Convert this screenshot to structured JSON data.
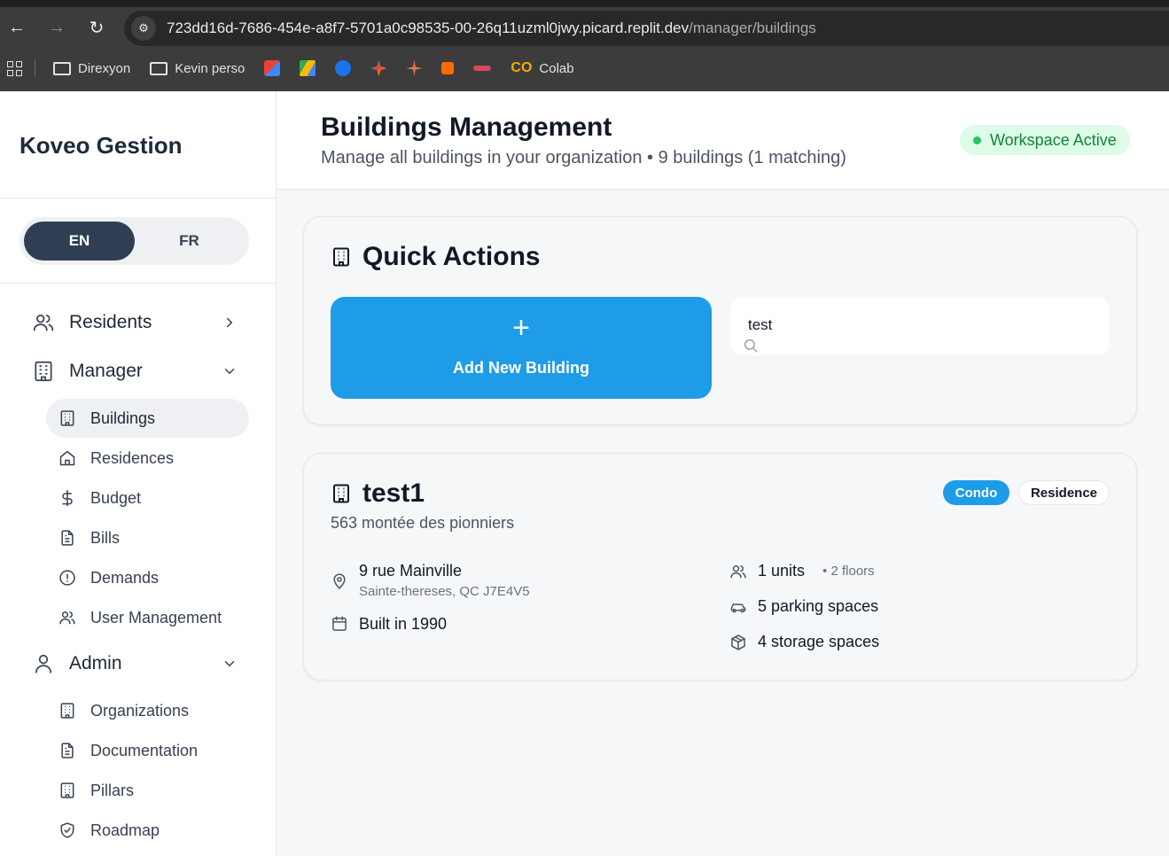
{
  "browser": {
    "url_host": "723dd16d-7686-454e-a8f7-5701a0c98535-00-26q11uzml0jwy.picard.replit.dev",
    "url_path": "/manager/buildings",
    "bookmarks": [
      {
        "label": "Direxyon",
        "icon": "folder-icon"
      },
      {
        "label": "Kevin perso",
        "icon": "folder-icon"
      },
      {
        "label": "Colab",
        "icon": "colab-icon"
      }
    ],
    "bookmark_icon_colors": [
      "#ea4335",
      "#34a853",
      "#1a73e8",
      "#8e7cc3",
      "#e8734a",
      "#ff6d00",
      "#d9475e"
    ]
  },
  "sidebar": {
    "brand": "Koveo Gestion",
    "language": {
      "en": "EN",
      "fr": "FR",
      "active": "EN"
    },
    "groups": [
      {
        "label": "Residents",
        "icon": "users-icon",
        "expanded": false
      },
      {
        "label": "Manager",
        "icon": "building-icon",
        "expanded": true
      },
      {
        "label": "Admin",
        "icon": "user-icon",
        "expanded": true
      }
    ],
    "manager_items": [
      {
        "label": "Buildings",
        "icon": "building-icon",
        "active": true
      },
      {
        "label": "Residences",
        "icon": "home-icon"
      },
      {
        "label": "Budget",
        "icon": "dollar-icon"
      },
      {
        "label": "Bills",
        "icon": "file-icon"
      },
      {
        "label": "Demands",
        "icon": "alert-circle-icon"
      },
      {
        "label": "User Management",
        "icon": "users-icon"
      }
    ],
    "admin_items": [
      {
        "label": "Organizations",
        "icon": "building-icon"
      },
      {
        "label": "Documentation",
        "icon": "file-icon"
      },
      {
        "label": "Pillars",
        "icon": "building-icon"
      },
      {
        "label": "Roadmap",
        "icon": "shield-icon"
      }
    ]
  },
  "header": {
    "title": "Buildings Management",
    "subtitle": "Manage all buildings in your organization • 9 buildings (1 matching)",
    "status_badge": "Workspace Active"
  },
  "quick_actions": {
    "title": "Quick Actions",
    "add_button": "Add New Building",
    "search_value": "test"
  },
  "building": {
    "name": "test1",
    "address_line": "563 montée des pionniers",
    "tags": [
      "Condo",
      "Residence"
    ],
    "location_street": "9 rue Mainville",
    "location_city": "Sainte-thereses, QC J7E4V5",
    "built": "Built in 1990",
    "units": "1 units",
    "floors": "• 2 floors",
    "parking": "5 parking spaces",
    "storage": "4 storage spaces"
  },
  "colors": {
    "accent": "#1e9ce8",
    "sidebar_active": "#2f3e52",
    "success": "#22c55e"
  }
}
